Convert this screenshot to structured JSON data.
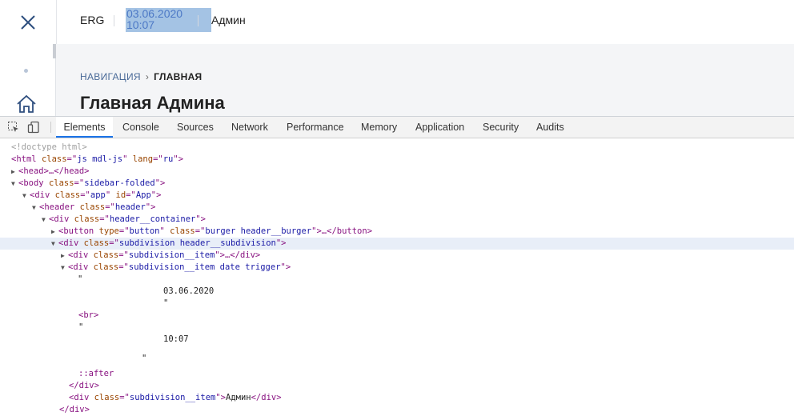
{
  "header": {
    "org": "ERG",
    "date": "03.06.2020",
    "time": "10:07",
    "user": "Админ"
  },
  "breadcrumb": {
    "nav_label": "НАВИГАЦИЯ",
    "separator": "›",
    "current": "ГЛАВНАЯ"
  },
  "page": {
    "title": "Главная Админа"
  },
  "devtools": {
    "tabs": [
      "Elements",
      "Console",
      "Sources",
      "Network",
      "Performance",
      "Memory",
      "Application",
      "Security",
      "Audits"
    ],
    "active_tab": "Elements",
    "dom": {
      "doctype": "<!doctype html>",
      "html_attrs": {
        "class": "js mdl-js",
        "lang": "ru"
      },
      "head": "<head>…</head>",
      "body_class": "sidebar-folded",
      "app_class": "app",
      "app_id": "App",
      "header_class": "header",
      "container_class": "header__container",
      "button_type": "button",
      "button_class": "burger header__burger",
      "subdivision_class": "subdivision header__subdivision",
      "item_class": "subdivision__item",
      "item_date_class": "subdivision__item date trigger",
      "text_date": "03.06.2020",
      "text_time": "10:07",
      "quote": "\"",
      "br": "<br>",
      "after": "::after",
      "admin_text": "Админ"
    }
  },
  "colors": {
    "accent": "#1a73e8",
    "selection": "#a4c3e4",
    "date_text": "#4d79c6"
  }
}
